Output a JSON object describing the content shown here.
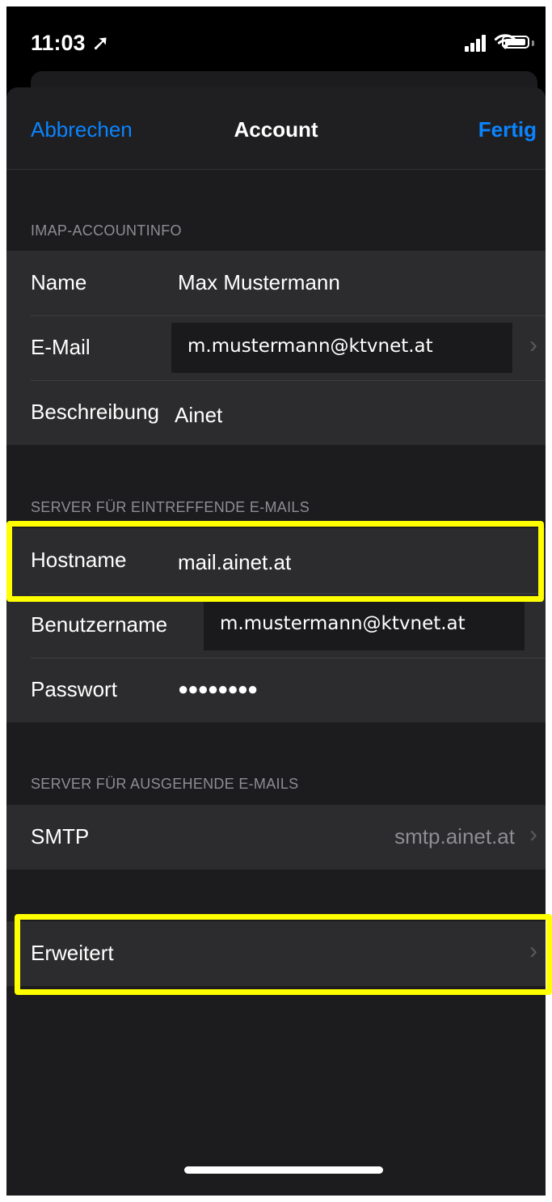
{
  "status_bar": {
    "time": "11:03 ➚"
  },
  "nav": {
    "cancel": "Abbrechen",
    "title": "Account",
    "done": "Fertig"
  },
  "imap_section": {
    "header": "IMAP-ACCOUNTINFO",
    "name_label": "Name",
    "name_value": "Max Mustermann",
    "email_label": "E-Mail",
    "email_value": "m.mustermann@ktvnet.at",
    "description_label": "Beschreibung",
    "description_value": "Ainet"
  },
  "incoming_section": {
    "header": "SERVER FÜR EINTREFFENDE E-MAILS",
    "hostname_label": "Hostname",
    "hostname_value": "mail.ainet.at",
    "username_label": "Benutzername",
    "username_value": "m.mustermann@ktvnet.at",
    "password_label": "Passwort",
    "password_value": "●●●●●●●●"
  },
  "outgoing_section": {
    "header": "SERVER FÜR AUSGEHENDE E-MAILS",
    "smtp_label": "SMTP",
    "smtp_value": "smtp.ainet.at"
  },
  "advanced": {
    "label": "Erweitert"
  },
  "colors": {
    "accent": "#0a84ff",
    "highlight": "#ffff00",
    "cell_background": "#2c2c2e"
  }
}
